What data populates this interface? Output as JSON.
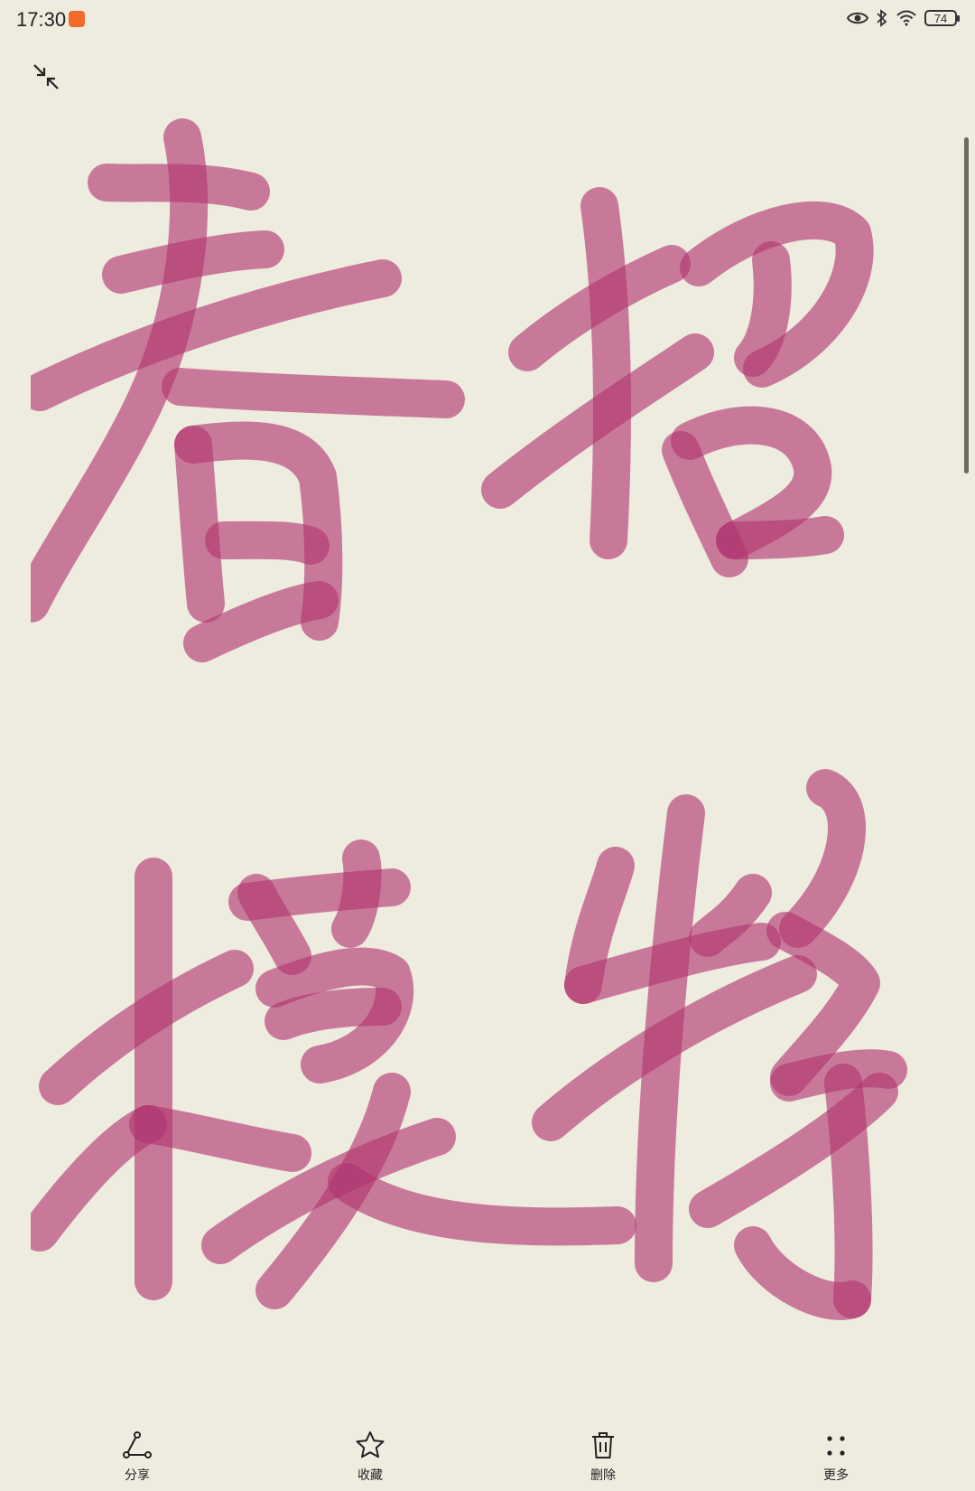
{
  "status_bar": {
    "time": "17:30",
    "battery": "74",
    "icons": [
      "notification-badge-icon",
      "eye-icon",
      "bluetooth-icon",
      "wifi-icon",
      "battery-icon"
    ]
  },
  "toolbar": {
    "share_label": "分享",
    "favorite_label": "收藏",
    "delete_label": "删除",
    "more_label": "更多"
  },
  "colors": {
    "background": "#eeebdf",
    "ink": "#b0346f"
  }
}
